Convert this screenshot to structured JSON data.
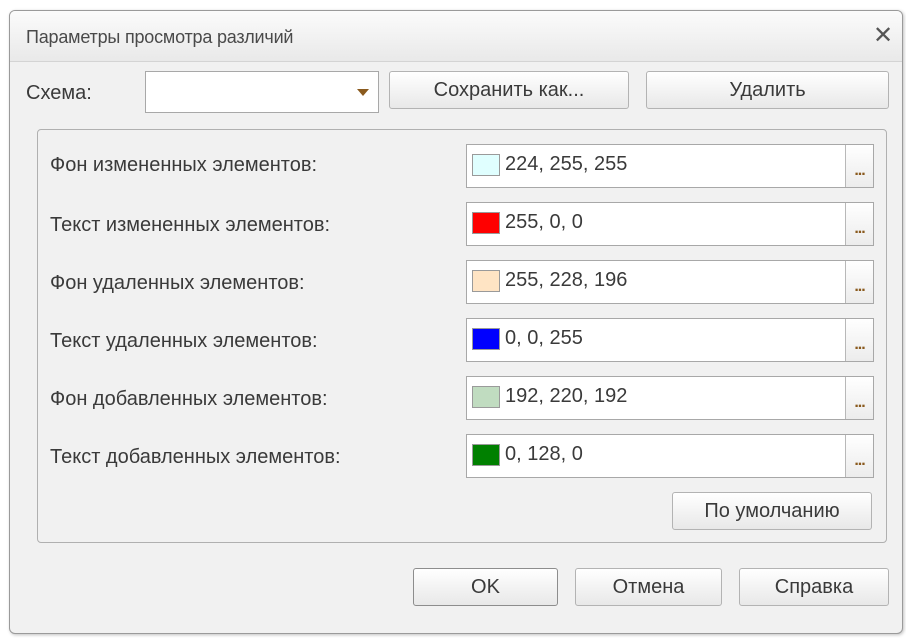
{
  "window": {
    "title": "Параметры просмотра различий",
    "close_glyph": "✕"
  },
  "scheme": {
    "label": "Схема:",
    "value": "",
    "save_as_label": "Сохранить как...",
    "delete_label": "Удалить"
  },
  "colors": [
    {
      "label": "Фон измененных элементов:",
      "value": "224, 255, 255",
      "swatch": "#E0FFFF"
    },
    {
      "label": "Текст измененных элементов:",
      "value": "255, 0, 0",
      "swatch": "#FF0000"
    },
    {
      "label": "Фон удаленных элементов:",
      "value": "255, 228, 196",
      "swatch": "#FFE4C4"
    },
    {
      "label": "Текст удаленных элементов:",
      "value": "0, 0, 255",
      "swatch": "#0000FF"
    },
    {
      "label": "Фон добавленных элементов:",
      "value": "192, 220, 192",
      "swatch": "#C0DCC0"
    },
    {
      "label": "Текст добавленных элементов:",
      "value": "0, 128, 0",
      "swatch": "#008000"
    }
  ],
  "picker_glyph": "...",
  "default_label": "По умолчанию",
  "footer": {
    "ok_label": "OK",
    "cancel_label": "Отмена",
    "help_label": "Справка"
  }
}
